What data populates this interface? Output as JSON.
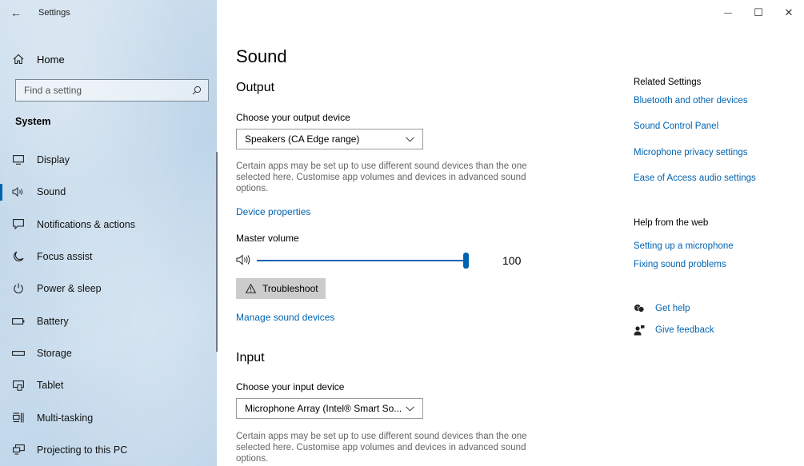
{
  "window": {
    "title": "Settings",
    "back_glyph": "←",
    "minimize_glyph": "—",
    "maximize_glyph": "☐",
    "close_glyph": "✕"
  },
  "sidebar": {
    "home_label": "Home",
    "search_placeholder": "Find a setting",
    "section_heading": "System",
    "items": [
      {
        "label": "Display",
        "icon": "display-icon"
      },
      {
        "label": "Sound",
        "icon": "speaker-icon",
        "active": true
      },
      {
        "label": "Notifications & actions",
        "icon": "notification-icon"
      },
      {
        "label": "Focus assist",
        "icon": "moon-icon"
      },
      {
        "label": "Power & sleep",
        "icon": "power-icon"
      },
      {
        "label": "Battery",
        "icon": "battery-icon"
      },
      {
        "label": "Storage",
        "icon": "storage-icon"
      },
      {
        "label": "Tablet",
        "icon": "tablet-icon"
      },
      {
        "label": "Multi-tasking",
        "icon": "multitasking-icon"
      },
      {
        "label": "Projecting to this PC",
        "icon": "projector-icon"
      }
    ]
  },
  "main": {
    "page_title": "Sound",
    "output": {
      "heading": "Output",
      "device_label": "Choose your output device",
      "device_value": "Speakers (CA Edge range)",
      "description": "Certain apps may be set up to use different sound devices than the one selected here. Customise app volumes and devices in advanced sound options.",
      "device_properties_link": "Device properties",
      "master_volume_label": "Master volume",
      "volume_value": "100",
      "volume_level": 1.0,
      "troubleshoot_label": "Troubleshoot",
      "manage_link": "Manage sound devices"
    },
    "input": {
      "heading": "Input",
      "device_label": "Choose your input device",
      "device_value": "Microphone Array (Intel® Smart So...",
      "description": "Certain apps may be set up to use different sound devices than the one selected here. Customise app volumes and devices in advanced sound options."
    }
  },
  "right": {
    "related_heading": "Related Settings",
    "related_links": [
      "Bluetooth and other devices",
      "Sound Control Panel",
      "Microphone privacy settings",
      "Ease of Access audio settings"
    ],
    "help_heading": "Help from the web",
    "help_links": [
      "Setting up a microphone",
      "Fixing sound problems"
    ],
    "get_help": "Get help",
    "give_feedback": "Give feedback"
  },
  "colors": {
    "accent": "#0063b1",
    "sidebar_bg": "#c3d8ea"
  }
}
